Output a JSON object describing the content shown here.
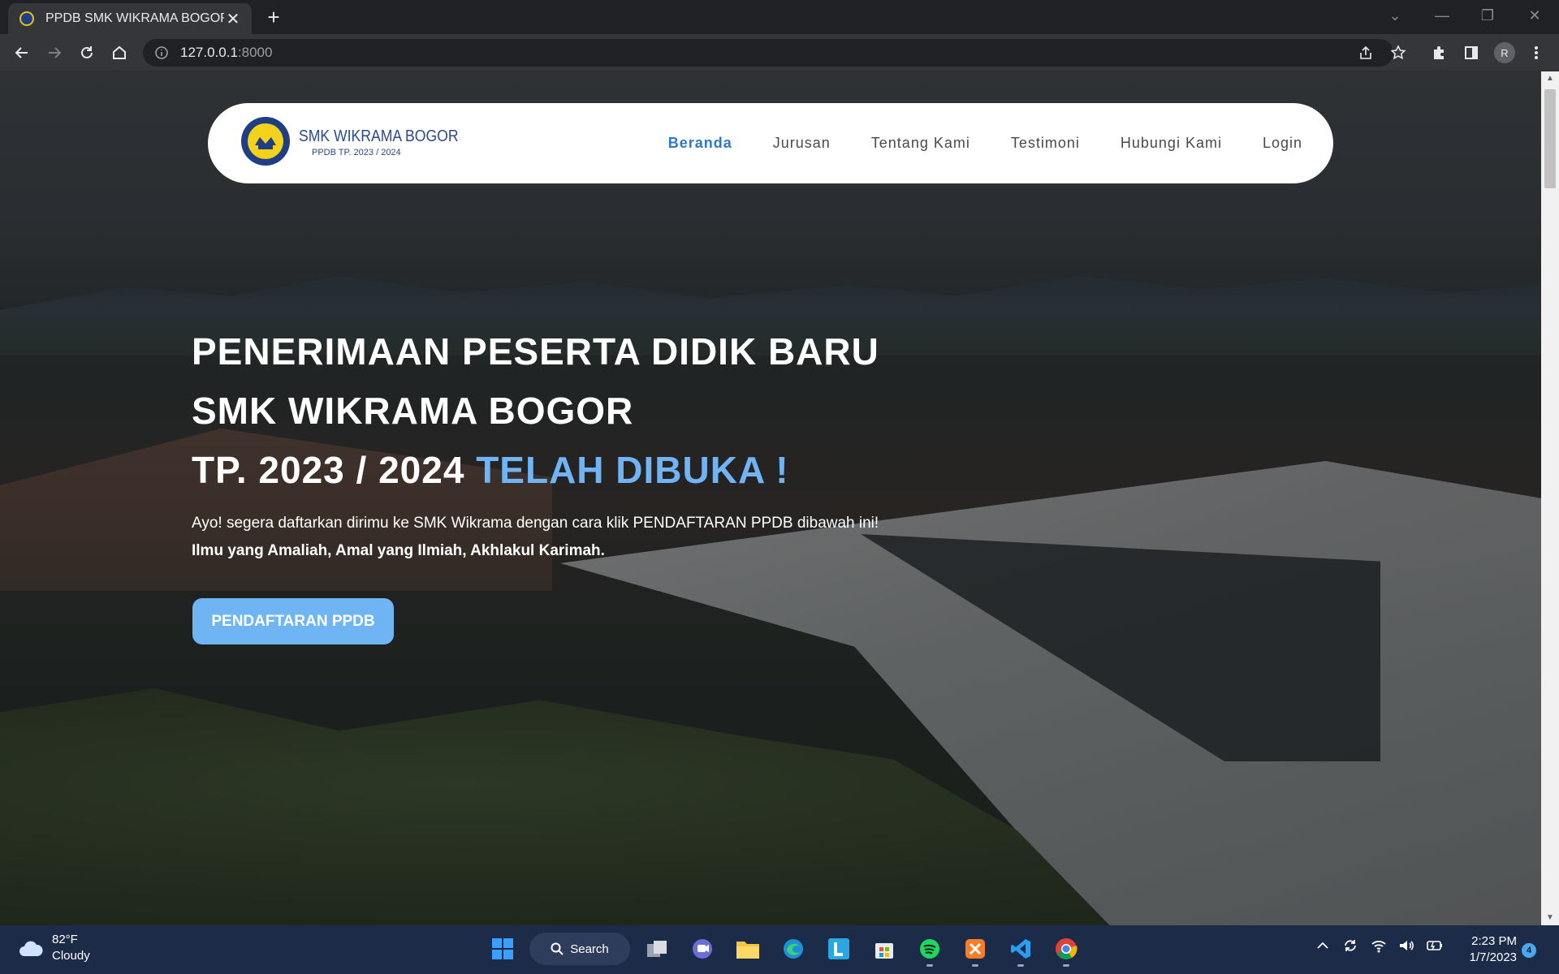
{
  "browser": {
    "tab_title": "PPDB SMK WIKRAMA BOGOR",
    "url_host": "127.0.0.1",
    "url_port": ":8000",
    "profile_initial": "R"
  },
  "navbar": {
    "brand_name": "SMK WIKRAMA BOGOR",
    "brand_sub": "PPDB TP. 2023 / 2024",
    "links": [
      {
        "label": "Beranda",
        "active": true
      },
      {
        "label": "Jurusan"
      },
      {
        "label": "Tentang Kami"
      },
      {
        "label": "Testimoni"
      },
      {
        "label": "Hubungi Kami"
      },
      {
        "label": "Login"
      }
    ]
  },
  "hero": {
    "line1": "PENERIMAAN PESERTA DIDIK BARU",
    "line2": "SMK WIKRAMA BOGOR",
    "line3_prefix": "TP. 2023 / 2024 ",
    "line3_accent": "TELAH DIBUKA !",
    "paragraph": "Ayo! segera daftarkan dirimu ke SMK Wikrama dengan cara klik PENDAFTARAN PPDB dibawah ini!",
    "motto": "Ilmu yang Amaliah, Amal yang Ilmiah, Akhlakul Karimah.",
    "cta_label": "PENDAFTARAN PPDB"
  },
  "taskbar": {
    "temperature": "82°F",
    "condition": "Cloudy",
    "search_label": "Search",
    "time": "2:23 PM",
    "date": "1/7/2023",
    "notification_count": "4",
    "apps": [
      "windows-start",
      "search",
      "task-view",
      "teams-chat",
      "file-explorer",
      "edge",
      "app-l",
      "store",
      "spotify",
      "xampp",
      "vscode",
      "chrome"
    ]
  },
  "colors": {
    "accent_blue": "#70b4f5",
    "nav_active": "#2f78c4",
    "taskbar": "#1c2b48"
  }
}
